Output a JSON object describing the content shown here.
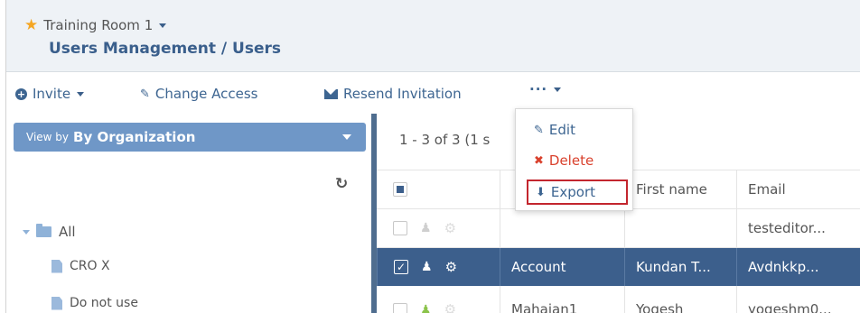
{
  "header": {
    "workspace": "Training Room 1",
    "title": "Users Management / Users"
  },
  "toolbar": {
    "invite": "Invite",
    "change_access": "Change Access",
    "resend_invitation": "Resend Invitation",
    "more": "···"
  },
  "more_menu": {
    "edit": "Edit",
    "delete": "Delete",
    "export": "Export"
  },
  "left_panel": {
    "view_by_label": "View by",
    "view_by_value": "By Organization",
    "tree": {
      "root": "All",
      "items": [
        "CRO X",
        "Do not use"
      ]
    }
  },
  "grid": {
    "count_text": "1 - 3 of 3 (1 s",
    "columns": [
      "",
      "",
      "First name",
      "Email"
    ],
    "rows": [
      {
        "last": "",
        "first": "",
        "email": "testeditor..."
      },
      {
        "last": "Account",
        "first": "Kundan T...",
        "email": "Avdnkkp..."
      },
      {
        "last": "Mahajan1",
        "first": "Yogesh",
        "email": "yogeshm0..."
      }
    ]
  },
  "colors": {
    "accent": "#3c5f8c",
    "view_by_bg": "#6f97c7",
    "delete": "#d9412d",
    "export_highlight": "#c3262e",
    "star": "#f5a623"
  }
}
